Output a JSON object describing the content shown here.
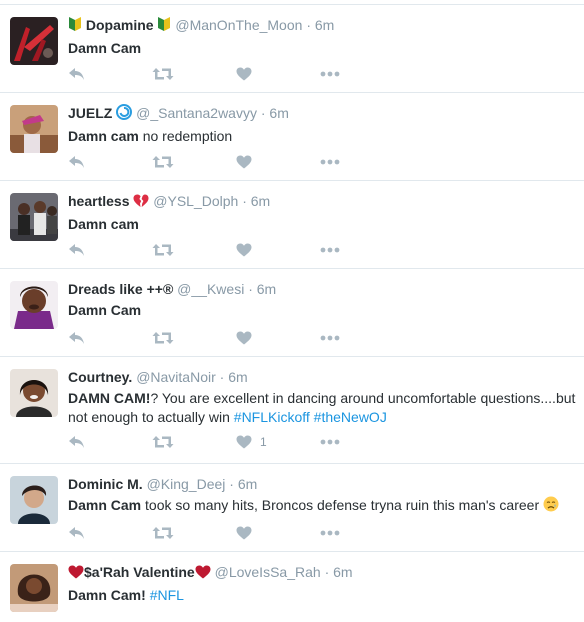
{
  "tweets": [
    {
      "name": "Dopamine",
      "name_prefix_emoji": "beginner-badge",
      "name_suffix_emoji": "beginner-badge",
      "handle": "@ManOnThe_Moon",
      "time": "6m",
      "text_bold": "Damn Cam",
      "text_rest": "",
      "hashtags": [],
      "like_count": ""
    },
    {
      "name": "JUELZ",
      "name_suffix_emoji": "cyclone",
      "handle": "@_Santana2wavyy",
      "time": "6m",
      "text_bold": "Damn cam",
      "text_rest": " no redemption",
      "hashtags": [],
      "like_count": ""
    },
    {
      "name": "heartless",
      "name_suffix_emoji": "broken-heart",
      "handle": "@YSL_Dolph",
      "time": "6m",
      "text_bold": "Damn cam",
      "text_rest": "",
      "hashtags": [],
      "like_count": ""
    },
    {
      "name": "Dreads like ++®",
      "handle": "@__Kwesi",
      "time": "6m",
      "text_bold": "Damn Cam",
      "text_rest": "",
      "hashtags": [],
      "like_count": ""
    },
    {
      "name": "Courtney.",
      "handle": "@NavitaNoir",
      "time": "6m",
      "text_bold": "DAMN CAM!",
      "text_rest": "? You are excellent in dancing around uncomfortable questions....but not enough to actually win ",
      "hashtags": [
        "#NFLKickoff",
        "#theNewOJ"
      ],
      "like_count": "1"
    },
    {
      "name": "Dominic M.",
      "handle": "@King_Deej",
      "time": "6m",
      "text_bold": "Damn Cam",
      "text_rest": " took so many hits, Broncos defense tryna ruin this man's career",
      "text_emoji": "crying-face",
      "hashtags": [],
      "like_count": ""
    },
    {
      "name": "$a'Rah Valentine",
      "name_prefix_emoji": "red-heart",
      "name_suffix_emoji": "red-heart",
      "handle": "@LoveIsSa_Rah",
      "time": "6m",
      "text_bold": "Damn Cam!",
      "text_rest": " ",
      "hashtags": [
        "#NFL"
      ],
      "like_count": ""
    }
  ],
  "separator": "·",
  "colors": {
    "text": "#292f33",
    "muted": "#8899a6",
    "icon": "#aab8c2",
    "hashtag": "#1b95e0",
    "border": "#e1e8ed"
  }
}
